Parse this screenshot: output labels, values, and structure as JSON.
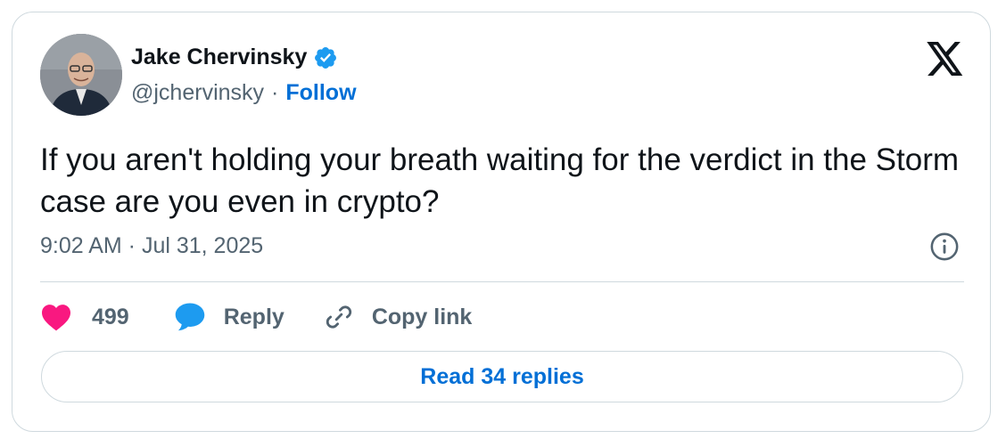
{
  "author": {
    "name": "Jake Chervinsky",
    "handle": "@jchervinsky",
    "separator": "·",
    "follow_label": "Follow",
    "verified_icon": "verified-badge-icon",
    "verified_color": "#1d9bf0"
  },
  "tweet": {
    "text": "If you aren't holding your breath waiting for the verdict in the Storm case are you even in crypto?",
    "timestamp": "9:02 AM · Jul 31, 2025"
  },
  "actions": {
    "like_count": "499",
    "like_color": "#f91880",
    "reply_label": "Reply",
    "reply_color": "#1d9bf0",
    "copy_link_label": "Copy link"
  },
  "footer": {
    "read_replies_label": "Read 34 replies"
  },
  "colors": {
    "link": "#006fd6",
    "muted": "#536471",
    "border": "#cfd9de",
    "text": "#0f1419"
  },
  "icons": [
    "x-logo-icon",
    "info-icon",
    "heart-icon",
    "comment-bubble-icon",
    "link-icon"
  ]
}
